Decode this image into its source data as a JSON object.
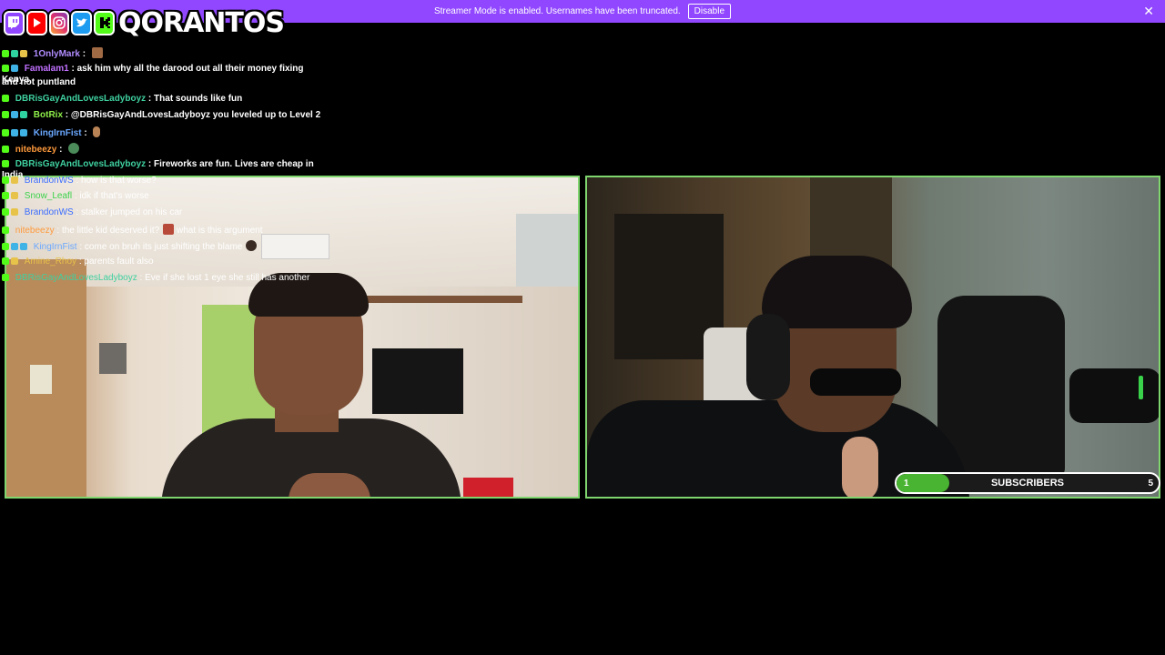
{
  "banner": {
    "text": "Streamer Mode is enabled. Usernames have been truncated.",
    "button_label": "Disable",
    "close_glyph": "✕",
    "color": "#9147ff"
  },
  "logo": {
    "channel_name": "QORANTOS",
    "icons": [
      "twitch-icon",
      "youtube-icon",
      "instagram-icon",
      "twitter-icon",
      "kick-icon"
    ]
  },
  "chat": {
    "messages": [
      {
        "user": "1OnlyMark",
        "color": "#b08cff",
        "text": "",
        "emote": "face"
      },
      {
        "user": "Famalam1",
        "color": "#c070ff",
        "text": "ask him why all the darood out all their money fixing Kenya",
        "emote": ""
      },
      {
        "user": "",
        "color": "#ffffff",
        "text": "and not puntland",
        "emote": ""
      },
      {
        "user": "DBRisGayAndLovesLadyboyz",
        "color": "#3fd0a0",
        "text": "That sounds like fun",
        "emote": ""
      },
      {
        "user": "BotRix",
        "color": "#8ff04a",
        "text": "@DBRisGayAndLovesLadyboyz you leveled up to Level 2",
        "emote": ""
      },
      {
        "user": "KingIrnFist",
        "color": "#6aa8ff",
        "text": "",
        "emote": "hand"
      },
      {
        "user": "nitebeezy",
        "color": "#ff9a3c",
        "text": "",
        "emote": "globe"
      },
      {
        "user": "DBRisGayAndLovesLadyboyz",
        "color": "#3fd0a0",
        "text": "Fireworks are fun. Lives are cheap in India",
        "emote": ""
      },
      {
        "user": "BrandonWS",
        "color": "#3a6cff",
        "text": "how is that worse?",
        "emote": ""
      },
      {
        "user": "Snow_Leafl",
        "color": "#3ad24a",
        "text": "idk if that's worse",
        "emote": ""
      },
      {
        "user": "BrandonWS",
        "color": "#3a6cff",
        "text": "stalker jumped on his car",
        "emote": ""
      },
      {
        "user": "nitebeezy",
        "color": "#ff9a3c",
        "text": "the little kid deserved it?",
        "emote": "red",
        "text2": "what is this argument"
      },
      {
        "user": "KingIrnFist",
        "color": "#6aa8ff",
        "text": "come on bruh its just shifting the blame",
        "emote": "dark"
      },
      {
        "user": "Amine_Rhoy",
        "color": "#e8c34a",
        "text": "parents fault also",
        "emote": ""
      },
      {
        "user": "DBRisGayAndLovesLadyboyz",
        "color": "#3fd0a0",
        "text": "Eve if she lost 1 eye she still has another",
        "emote": ""
      }
    ]
  },
  "subscriber_goal": {
    "label": "SUBSCRIBERS",
    "current": "1",
    "target": "5",
    "progress_fraction": 0.2,
    "bar_color": "#49b432"
  },
  "panels": {
    "border_color": "#7fd66f"
  }
}
